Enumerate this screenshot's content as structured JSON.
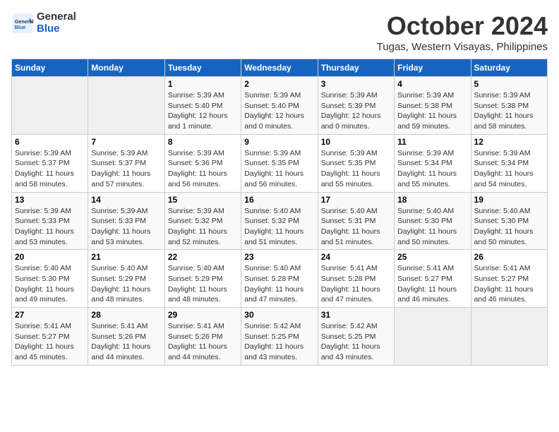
{
  "logo": {
    "general": "General",
    "blue": "Blue"
  },
  "title": "October 2024",
  "location": "Tugas, Western Visayas, Philippines",
  "days_header": [
    "Sunday",
    "Monday",
    "Tuesday",
    "Wednesday",
    "Thursday",
    "Friday",
    "Saturday"
  ],
  "weeks": [
    [
      {
        "day": "",
        "info": ""
      },
      {
        "day": "",
        "info": ""
      },
      {
        "day": "1",
        "info": "Sunrise: 5:39 AM\nSunset: 5:40 PM\nDaylight: 12 hours\nand 1 minute."
      },
      {
        "day": "2",
        "info": "Sunrise: 5:39 AM\nSunset: 5:40 PM\nDaylight: 12 hours\nand 0 minutes."
      },
      {
        "day": "3",
        "info": "Sunrise: 5:39 AM\nSunset: 5:39 PM\nDaylight: 12 hours\nand 0 minutes."
      },
      {
        "day": "4",
        "info": "Sunrise: 5:39 AM\nSunset: 5:38 PM\nDaylight: 11 hours\nand 59 minutes."
      },
      {
        "day": "5",
        "info": "Sunrise: 5:39 AM\nSunset: 5:38 PM\nDaylight: 11 hours\nand 58 minutes."
      }
    ],
    [
      {
        "day": "6",
        "info": "Sunrise: 5:39 AM\nSunset: 5:37 PM\nDaylight: 11 hours\nand 58 minutes."
      },
      {
        "day": "7",
        "info": "Sunrise: 5:39 AM\nSunset: 5:37 PM\nDaylight: 11 hours\nand 57 minutes."
      },
      {
        "day": "8",
        "info": "Sunrise: 5:39 AM\nSunset: 5:36 PM\nDaylight: 11 hours\nand 56 minutes."
      },
      {
        "day": "9",
        "info": "Sunrise: 5:39 AM\nSunset: 5:35 PM\nDaylight: 11 hours\nand 56 minutes."
      },
      {
        "day": "10",
        "info": "Sunrise: 5:39 AM\nSunset: 5:35 PM\nDaylight: 11 hours\nand 55 minutes."
      },
      {
        "day": "11",
        "info": "Sunrise: 5:39 AM\nSunset: 5:34 PM\nDaylight: 11 hours\nand 55 minutes."
      },
      {
        "day": "12",
        "info": "Sunrise: 5:39 AM\nSunset: 5:34 PM\nDaylight: 11 hours\nand 54 minutes."
      }
    ],
    [
      {
        "day": "13",
        "info": "Sunrise: 5:39 AM\nSunset: 5:33 PM\nDaylight: 11 hours\nand 53 minutes."
      },
      {
        "day": "14",
        "info": "Sunrise: 5:39 AM\nSunset: 5:33 PM\nDaylight: 11 hours\nand 53 minutes."
      },
      {
        "day": "15",
        "info": "Sunrise: 5:39 AM\nSunset: 5:32 PM\nDaylight: 11 hours\nand 52 minutes."
      },
      {
        "day": "16",
        "info": "Sunrise: 5:40 AM\nSunset: 5:32 PM\nDaylight: 11 hours\nand 51 minutes."
      },
      {
        "day": "17",
        "info": "Sunrise: 5:40 AM\nSunset: 5:31 PM\nDaylight: 11 hours\nand 51 minutes."
      },
      {
        "day": "18",
        "info": "Sunrise: 5:40 AM\nSunset: 5:30 PM\nDaylight: 11 hours\nand 50 minutes."
      },
      {
        "day": "19",
        "info": "Sunrise: 5:40 AM\nSunset: 5:30 PM\nDaylight: 11 hours\nand 50 minutes."
      }
    ],
    [
      {
        "day": "20",
        "info": "Sunrise: 5:40 AM\nSunset: 5:30 PM\nDaylight: 11 hours\nand 49 minutes."
      },
      {
        "day": "21",
        "info": "Sunrise: 5:40 AM\nSunset: 5:29 PM\nDaylight: 11 hours\nand 48 minutes."
      },
      {
        "day": "22",
        "info": "Sunrise: 5:40 AM\nSunset: 5:29 PM\nDaylight: 11 hours\nand 48 minutes."
      },
      {
        "day": "23",
        "info": "Sunrise: 5:40 AM\nSunset: 5:28 PM\nDaylight: 11 hours\nand 47 minutes."
      },
      {
        "day": "24",
        "info": "Sunrise: 5:41 AM\nSunset: 5:28 PM\nDaylight: 11 hours\nand 47 minutes."
      },
      {
        "day": "25",
        "info": "Sunrise: 5:41 AM\nSunset: 5:27 PM\nDaylight: 11 hours\nand 46 minutes."
      },
      {
        "day": "26",
        "info": "Sunrise: 5:41 AM\nSunset: 5:27 PM\nDaylight: 11 hours\nand 46 minutes."
      }
    ],
    [
      {
        "day": "27",
        "info": "Sunrise: 5:41 AM\nSunset: 5:27 PM\nDaylight: 11 hours\nand 45 minutes."
      },
      {
        "day": "28",
        "info": "Sunrise: 5:41 AM\nSunset: 5:26 PM\nDaylight: 11 hours\nand 44 minutes."
      },
      {
        "day": "29",
        "info": "Sunrise: 5:41 AM\nSunset: 5:26 PM\nDaylight: 11 hours\nand 44 minutes."
      },
      {
        "day": "30",
        "info": "Sunrise: 5:42 AM\nSunset: 5:25 PM\nDaylight: 11 hours\nand 43 minutes."
      },
      {
        "day": "31",
        "info": "Sunrise: 5:42 AM\nSunset: 5:25 PM\nDaylight: 11 hours\nand 43 minutes."
      },
      {
        "day": "",
        "info": ""
      },
      {
        "day": "",
        "info": ""
      }
    ]
  ]
}
